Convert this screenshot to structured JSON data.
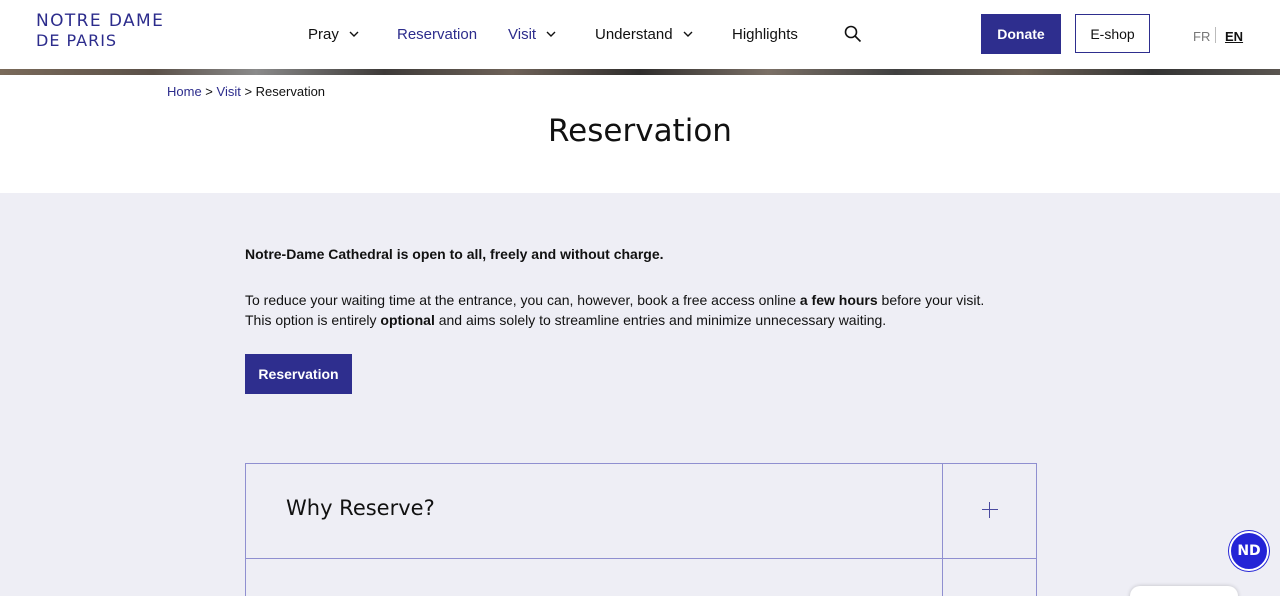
{
  "brand": {
    "line1": "NOTRE DAME",
    "line2": "DE PARIS",
    "color": "#2c2c8c"
  },
  "nav": {
    "pray": "Pray",
    "reservation": "Reservation",
    "visit": "Visit",
    "understand": "Understand",
    "highlights": "Highlights"
  },
  "header": {
    "donate": "Donate",
    "eshop": "E-shop",
    "lang_fr": "FR",
    "lang_en": "EN"
  },
  "breadcrumb": {
    "home": "Home",
    "sep1": " > ",
    "visit": "Visit",
    "sep2": " > ",
    "current": "Reservation"
  },
  "page": {
    "title": "Reservation"
  },
  "content": {
    "intro": "Notre-Dame Cathedral is open to all, freely and without charge.",
    "p1_a": "To reduce your waiting time at the entrance, you can, however, book a free access online ",
    "p1_b": "a few hours",
    "p1_c": " before your visit.",
    "p2_a": "This option is entirely ",
    "p2_b": "optional",
    "p2_c": " and aims solely to streamline entries and minimize unnecessary waiting.",
    "button": "Reservation"
  },
  "accordion": {
    "items": [
      {
        "title": "Why Reserve?"
      }
    ]
  },
  "badge": {
    "label": "ND"
  },
  "colors": {
    "accent": "#2e2e8e",
    "band": "#eeeef5",
    "border": "#8f8fd0"
  }
}
